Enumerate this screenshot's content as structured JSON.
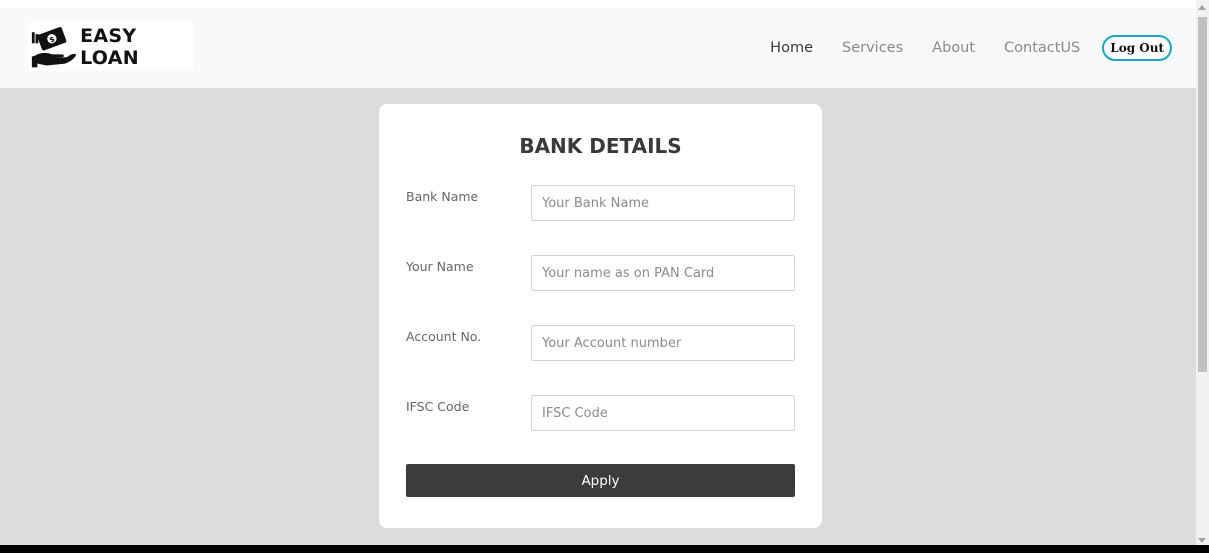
{
  "brand": {
    "name": "EASY LOAN",
    "logo_icon": "hand-money-icon"
  },
  "nav": {
    "items": [
      {
        "label": "Home",
        "active": true
      },
      {
        "label": "Services",
        "active": false
      },
      {
        "label": "About",
        "active": false
      },
      {
        "label": "ContactUS",
        "active": false
      }
    ],
    "logout_label": "Log Out"
  },
  "form": {
    "title": "BANK DETAILS",
    "fields": [
      {
        "label": "Bank Name",
        "placeholder": "Your Bank Name",
        "value": ""
      },
      {
        "label": "Your Name",
        "placeholder": "Your name as on PAN Card",
        "value": ""
      },
      {
        "label": "Account No.",
        "placeholder": "Your Account number",
        "value": ""
      },
      {
        "label": "IFSC Code",
        "placeholder": "IFSC Code",
        "value": ""
      }
    ],
    "submit_label": "Apply"
  },
  "colors": {
    "page_bg": "#dcdcdc",
    "navbar_bg": "#f8f9fa",
    "button_bg": "#3c3c3c",
    "logout_border": "#1aa7c4"
  }
}
